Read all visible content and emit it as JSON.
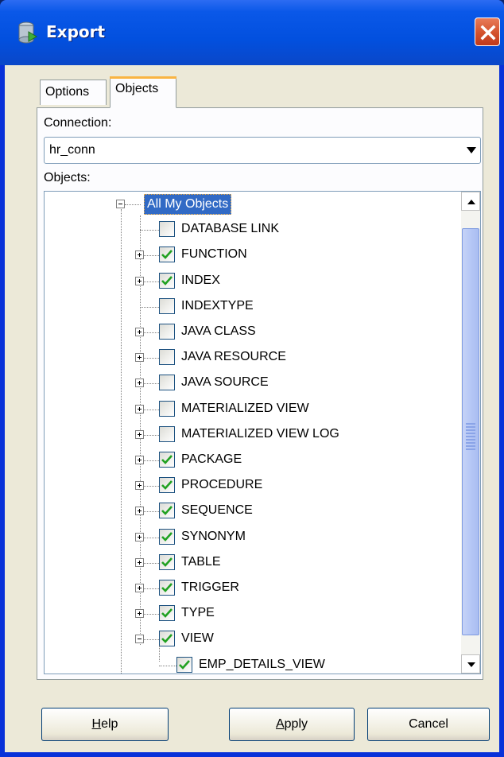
{
  "window": {
    "title": "Export"
  },
  "tabs": [
    {
      "label": "Options",
      "selected": false
    },
    {
      "label": "Objects",
      "selected": true
    }
  ],
  "connection": {
    "label": "Connection:",
    "value": "hr_conn"
  },
  "objects_label": "Objects:",
  "tree": {
    "root": {
      "label": "All My Objects",
      "expanded": true,
      "selected": true
    },
    "items": [
      {
        "label": "DATABASE LINK",
        "checked": false,
        "expandable": false
      },
      {
        "label": "FUNCTION",
        "checked": true,
        "expandable": true
      },
      {
        "label": "INDEX",
        "checked": true,
        "expandable": true
      },
      {
        "label": "INDEXTYPE",
        "checked": false,
        "expandable": false
      },
      {
        "label": "JAVA CLASS",
        "checked": false,
        "expandable": true
      },
      {
        "label": "JAVA RESOURCE",
        "checked": false,
        "expandable": true
      },
      {
        "label": "JAVA SOURCE",
        "checked": false,
        "expandable": true
      },
      {
        "label": "MATERIALIZED VIEW",
        "checked": false,
        "expandable": true
      },
      {
        "label": "MATERIALIZED VIEW LOG",
        "checked": false,
        "expandable": true
      },
      {
        "label": "PACKAGE",
        "checked": true,
        "expandable": true
      },
      {
        "label": "PROCEDURE",
        "checked": true,
        "expandable": true
      },
      {
        "label": "SEQUENCE",
        "checked": true,
        "expandable": true
      },
      {
        "label": "SYNONYM",
        "checked": true,
        "expandable": true
      },
      {
        "label": "TABLE",
        "checked": true,
        "expandable": true
      },
      {
        "label": "TRIGGER",
        "checked": true,
        "expandable": true
      },
      {
        "label": "TYPE",
        "checked": true,
        "expandable": true
      },
      {
        "label": "VIEW",
        "checked": true,
        "expandable": true,
        "expanded": true
      }
    ],
    "child_items": [
      {
        "label": "EMP_DETAILS_VIEW",
        "checked": true
      }
    ]
  },
  "buttons": {
    "help": {
      "label": "Help",
      "mnemonic": "H"
    },
    "apply": {
      "label": "Apply",
      "mnemonic": "A"
    },
    "cancel": {
      "label": "Cancel"
    }
  },
  "colors": {
    "title_bar": "#0250df",
    "dialog_bg": "#ece9d8",
    "selection": "#316ac5",
    "close_button": "#d3512c"
  }
}
